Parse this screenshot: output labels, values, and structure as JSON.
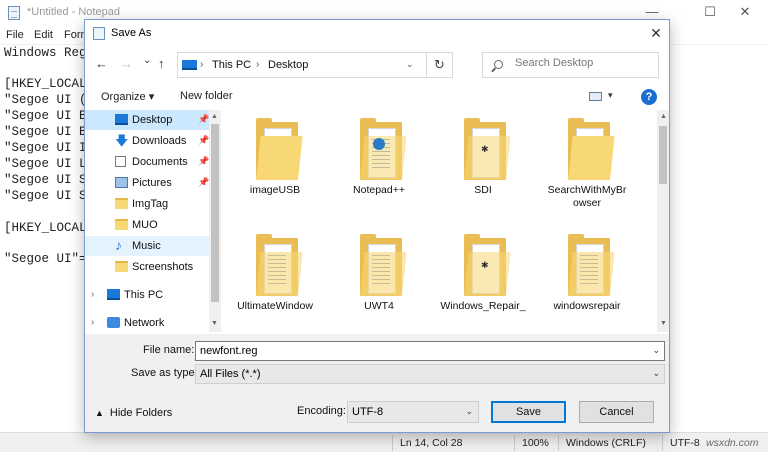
{
  "notepad": {
    "title": "*Untitled - Notepad",
    "window_controls": {
      "minimize": "—",
      "maximize": "☐",
      "close": "✕"
    },
    "menu": [
      "File",
      "Edit",
      "Form"
    ],
    "lines": [
      "Windows Reg",
      "",
      "[HKEY_LOCAL_",
      "\"Segoe UI (T",
      "\"Segoe UI Bo",
      "\"Segoe UI Bo",
      "\"Segoe UI It",
      "\"Segoe UI Li",
      "\"Segoe UI Se",
      "\"Segoe UI Sy",
      "",
      "[HKEY_LOCAL_",
      "",
      "\"Segoe UI\"=\""
    ],
    "status": {
      "position": "Ln 14, Col 28",
      "zoom": "100%",
      "line_ending": "Windows (CRLF)",
      "encoding": "UTF-8",
      "watermark": "wsxdn.com"
    }
  },
  "dialog": {
    "title": "Save As",
    "close_glyph": "✕",
    "nav": {
      "back": "←",
      "forward": "→",
      "recent": "⌄",
      "up": "↑"
    },
    "address": {
      "root": "This PC",
      "current": "Desktop",
      "separator": "›",
      "dropdown": "⌄",
      "refresh": "↻"
    },
    "search_placeholder": "Search Desktop",
    "toolbar": {
      "organize": "Organize ▾",
      "new_folder": "New folder",
      "view_dropdown": "▾",
      "help": "?"
    },
    "nav_pane": [
      {
        "label": "Desktop",
        "icon": "desktop-icon",
        "pinned": true,
        "selected": true
      },
      {
        "label": "Downloads",
        "icon": "download-icon",
        "pinned": true
      },
      {
        "label": "Documents",
        "icon": "documents-icon",
        "pinned": true
      },
      {
        "label": "Pictures",
        "icon": "pictures-icon",
        "pinned": true
      },
      {
        "label": "ImgTag",
        "icon": "folder-icon"
      },
      {
        "label": "MUO",
        "icon": "folder-icon"
      },
      {
        "label": "Music",
        "icon": "music-icon",
        "hovered": true
      },
      {
        "label": "Screenshots",
        "icon": "folder-icon"
      },
      {
        "label": "This PC",
        "icon": "this-pc-icon",
        "expandable": true
      },
      {
        "label": "Network",
        "icon": "network-icon",
        "expandable": true
      }
    ],
    "pin_glyph": "📌",
    "expand_glyph": "›",
    "folders": [
      {
        "name": "imageUSB",
        "variant": "plain"
      },
      {
        "name": "Notepad++",
        "variant": "badge"
      },
      {
        "name": "SDI",
        "variant": "dot"
      },
      {
        "name": "SearchWithMyBr\nowser",
        "variant": "plain"
      },
      {
        "name": "UltimateWindow",
        "variant": "lines"
      },
      {
        "name": "UWT4",
        "variant": "lines"
      },
      {
        "name": "Windows_Repair_",
        "variant": "dot"
      },
      {
        "name": "windowsrepair",
        "variant": "lines"
      }
    ],
    "file_name_label": "File name:",
    "file_name_value": "newfont.reg",
    "save_type_label": "Save as type:",
    "save_type_value": "All Files  (*.*)",
    "hide_folders": "Hide Folders",
    "encoding_label": "Encoding:",
    "encoding_value": "UTF-8",
    "save_button": "Save",
    "cancel_button": "Cancel",
    "dropdown_glyph": "⌄",
    "hide_glyph": "▲"
  },
  "colors": {
    "accent": "#0078d7",
    "selection": "#cce8ff",
    "folder": "#f8d775"
  }
}
